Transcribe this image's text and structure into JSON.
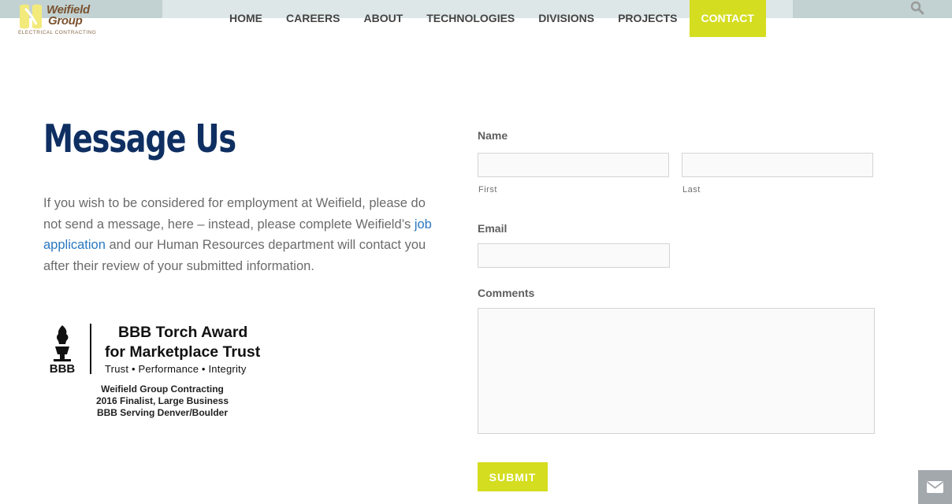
{
  "brand": {
    "name_line1": "Weifield",
    "name_line2": "Group",
    "tagline": "ELECTRICAL CONTRACTING",
    "colors": {
      "accent": "#d4dd1f",
      "title": "#0f2f62",
      "link": "#2878c0",
      "logo_brown": "#7a5230"
    }
  },
  "nav": {
    "items": [
      {
        "label": "HOME"
      },
      {
        "label": "CAREERS"
      },
      {
        "label": "ABOUT"
      },
      {
        "label": "TECHNOLOGIES"
      },
      {
        "label": "DIVISIONS"
      },
      {
        "label": "PROJECTS"
      },
      {
        "label": "CONTACT",
        "active": true
      }
    ],
    "search_icon": "search-icon"
  },
  "main": {
    "title": "Message Us",
    "intro_before": "If you wish to be considered for employment at Weifield, please do not send a message, here – instead, please complete Weifield’s ",
    "intro_link": "job application",
    "intro_after": "  and our Human Resources department will contact you after their review of your submitted information."
  },
  "award": {
    "mark": "BBB",
    "title_line1": "BBB Torch Award",
    "title_line2": "for Marketplace Trust",
    "values": "Trust  •  Performance  •  Integrity",
    "footer_line1": "Weifield Group Contracting",
    "footer_line2": "2016 Finalist, Large Business",
    "footer_line3": "BBB Serving Denver/Boulder"
  },
  "form": {
    "name_label": "Name",
    "first_label": "First",
    "last_label": "Last",
    "first_value": "",
    "last_value": "",
    "email_label": "Email",
    "email_value": "",
    "comments_label": "Comments",
    "comments_value": "",
    "submit_label": "SUBMIT"
  },
  "floating": {
    "mail_icon": "envelope-icon"
  }
}
